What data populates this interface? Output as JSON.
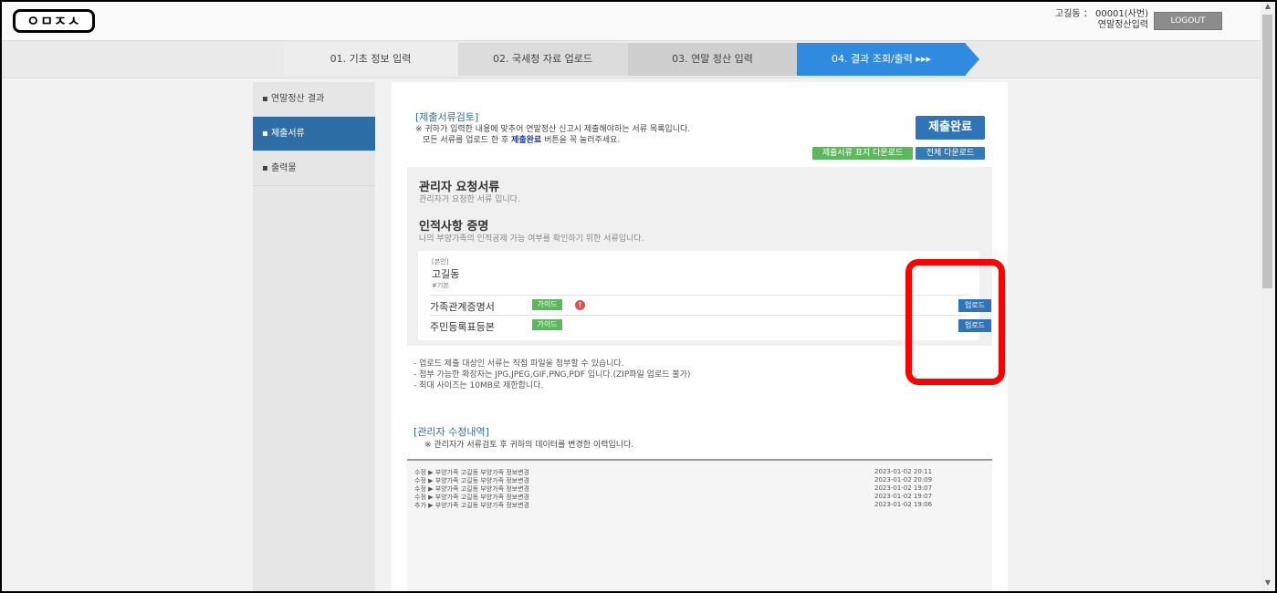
{
  "header": {
    "logo": "ㅇㅁㅈㅅ",
    "user_line": "고길동 ： 00001(사번)",
    "user_sub": "연말정산입력",
    "logout": "LOGOUT"
  },
  "steps": [
    "01. 기초 정보 입력",
    "02. 국세청 자료 업로드",
    "03. 연말 정산 입력",
    "04. 결과 조회/출력 ▸▸▸"
  ],
  "sidebar": {
    "items": [
      {
        "label": "▪ 연말정산 결과"
      },
      {
        "label": "▪ 제출서류"
      },
      {
        "label": "▪ 출력물"
      }
    ]
  },
  "review": {
    "title": "[제출서류검토]",
    "notice1": "※ 귀하가 입력한 내용에 맞추어 연말정산 신고시 제출해야하는 서류 목록입니다.",
    "notice2_a": "모든 서류를 업로드 한 후 ",
    "notice2_b": "제출완료",
    "notice2_c": " 버튼을 꼭 눌러주세요.",
    "complete_button": "제출완료",
    "cover_download": "제출서류 표지 다운로드",
    "all_download": "전체 다운로드"
  },
  "admin_docs": {
    "title": "관리자 요청서류",
    "desc": "관리자가 요청한 서류 입니다."
  },
  "person_docs": {
    "title": "인적사항 증명",
    "desc": "나의 부양가족의 인적공제 가능 여부를 확인하기 위한 서류입니다.",
    "tag": "[본인]",
    "name": "고길동",
    "sub": "#기본",
    "rows": [
      {
        "name": "가족관계증명서",
        "guide": "가이드",
        "upload": "업로드"
      },
      {
        "name": "주민등록표등본",
        "guide": "가이드",
        "upload": "업로드"
      }
    ]
  },
  "info_lines": [
    "- 업로드 제출 대상인 서류는 직접 파일을 첨부할 수 있습니다.",
    "- 첨부 가능한 확장자는 JPG,JPEG,GIF,PNG,PDF 입니다.(ZIP파일 업로드 불가)",
    "- 최대 사이즈는 10MB로 제한합니다."
  ],
  "history": {
    "title": "[관리자 수정내역]",
    "notice": "※ 관리자가 서류검토 후 귀하의 데이터를 변경한 이력입니다.",
    "rows": [
      {
        "text": "수정 ▶ 부양가족 고길동 부양가족 정보변경",
        "date": "2023-01-02 20:11"
      },
      {
        "text": "수정 ▶ 부양가족 고길동 부양가족 정보변경",
        "date": "2023-01-02 20:09"
      },
      {
        "text": "수정 ▶ 부양가족 고길동 부양가족 정보변경",
        "date": "2023-01-02 19:07"
      },
      {
        "text": "수정 ▶ 부양가족 고길동 부양가족 정보변경",
        "date": "2023-01-02 19:07"
      },
      {
        "text": "추가 ▶ 부양가족 고길동 부양가족 정보변경",
        "date": "2023-01-02 19:06"
      }
    ]
  }
}
